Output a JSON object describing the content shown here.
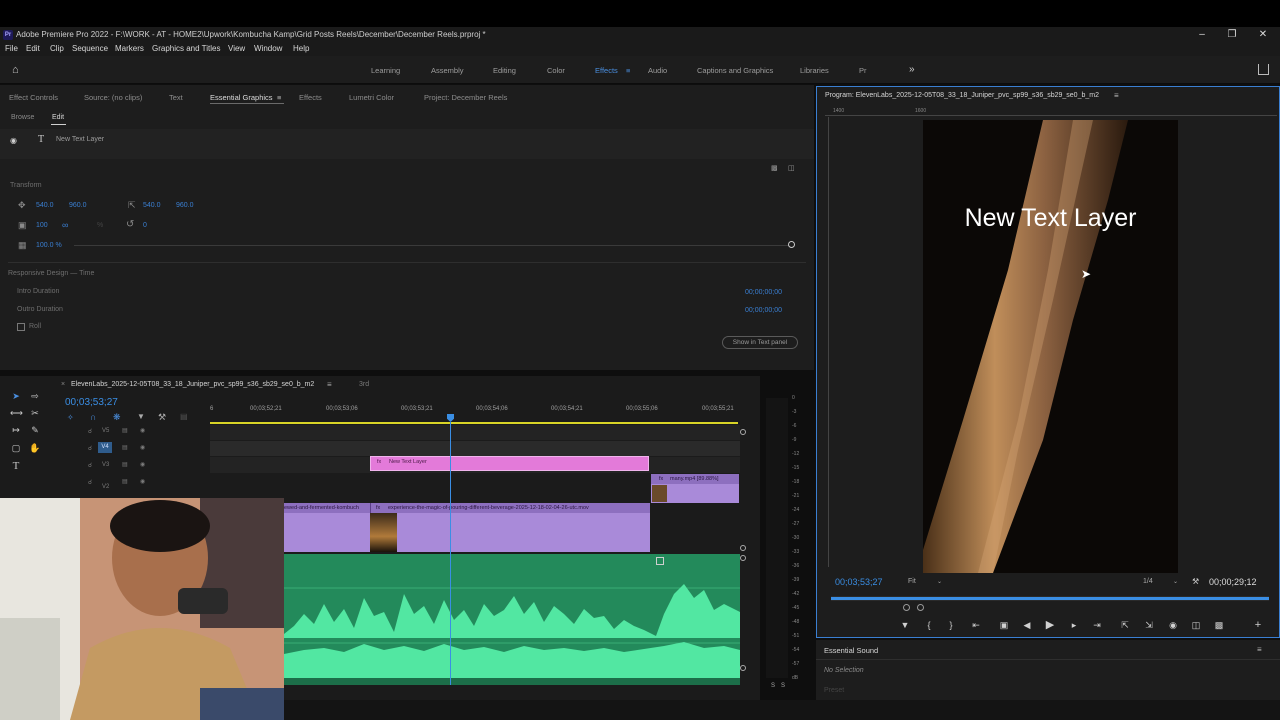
{
  "app": {
    "title": "Adobe Premiere Pro 2022 - F:\\WORK - AT - HOME2\\Upwork\\Kombucha Kamp\\Grid Posts Reels\\December\\December Reels.prproj *",
    "logo": "Pr"
  },
  "menu": [
    "File",
    "Edit",
    "Clip",
    "Sequence",
    "Markers",
    "Graphics and Titles",
    "View",
    "Window",
    "Help"
  ],
  "workspaces": [
    "Learning",
    "Assembly",
    "Editing",
    "Color",
    "Effects",
    "Audio",
    "Captions and Graphics",
    "Libraries",
    "Pr"
  ],
  "workspace_active": "Effects",
  "left_tabs": [
    "Effect Controls",
    "Source: (no clips)",
    "Text",
    "Essential Graphics",
    "Effects",
    "Lumetri Color",
    "Project: December Reels"
  ],
  "eg": {
    "subtabs": [
      "Browse",
      "Edit"
    ],
    "layer_name": "New Text Layer",
    "transform_label": "Transform",
    "pos_x": "540.0",
    "pos_y": "960.0",
    "anchor_x": "540.0",
    "anchor_y": "960.0",
    "scale": "100",
    "rotation": "0",
    "opacity": "100.0 %",
    "responsive_label": "Responsive Design — Time",
    "intro_label": "Intro Duration",
    "intro_value": "00;00;00;00",
    "outro_label": "Outro Duration",
    "outro_value": "00;00;00;00",
    "roll_label": "Roll",
    "show_button": "Show in Text panel"
  },
  "timeline": {
    "sequence_name": "ElevenLabs_2025-12-05T08_33_18_Juniper_pvc_sp99_s36_sb29_se0_b_m2",
    "second_tab": "3rd",
    "timecode": "00;03;53;27",
    "ruler": [
      "00;03;52;21",
      "00;03;53;06",
      "00;03;53;21",
      "00;03;54;06",
      "00;03;54;21",
      "00;03;55;06",
      "00;03;55;21"
    ],
    "ruler_prefix": "6",
    "tracks": [
      "V5",
      "V4",
      "V3",
      "V2"
    ],
    "clips": {
      "text": "New Text Layer",
      "many": "many.mp4 [89.88%]",
      "brewed": "ewed-and-fermented-kombuch",
      "pouring": "experience-the-magic-of-pouring-different-beverage-2025-12-18-02-04-26-utc.mov"
    }
  },
  "meter": {
    "scale": [
      "0",
      "-3",
      "-6",
      "-9",
      "-12",
      "-15",
      "-18",
      "-21",
      "-24",
      "-27",
      "-30",
      "-33",
      "-36",
      "-39",
      "-42",
      "-45",
      "-48",
      "-51",
      "-54",
      "-57",
      "dB"
    ],
    "bottom": [
      "S",
      "S"
    ]
  },
  "program": {
    "title": "Program: ElevenLabs_2025-12-05T08_33_18_Juniper_pvc_sp99_s36_sb29_se0_b_m2",
    "overlay_text": "New Text Layer",
    "timecode": "00;03;53;27",
    "fit": "Fit",
    "resolution": "1/4",
    "duration": "00;00;29;12",
    "ruler": [
      "1400",
      "1600"
    ]
  },
  "essential_sound": {
    "title": "Essential Sound",
    "no_selection": "No Selection",
    "preset": "Preset"
  },
  "colors": {
    "accent_blue": "#3a7fd2",
    "clip_pink": "#e37ad9",
    "clip_purple": "#a98ad9",
    "audio_green": "#238a5b",
    "waveform": "#52e7a2"
  }
}
